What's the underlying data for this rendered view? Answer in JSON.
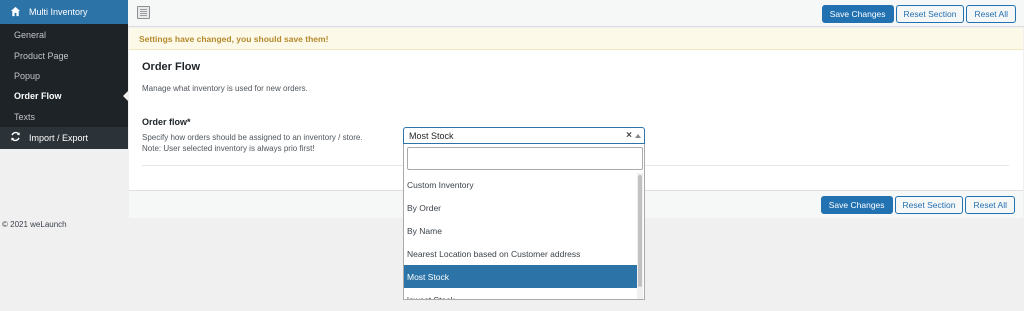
{
  "sidebar": {
    "title": "Multi Inventory",
    "items": [
      {
        "label": "General"
      },
      {
        "label": "Product Page"
      },
      {
        "label": "Popup"
      },
      {
        "label": "Order Flow"
      },
      {
        "label": "Texts"
      }
    ],
    "import_export": "Import / Export"
  },
  "toolbar": {
    "save_label": "Save Changes",
    "reset_section_label": "Reset Section",
    "reset_all_label": "Reset All"
  },
  "notice": "Settings have changed, you should save them!",
  "section": {
    "title": "Order Flow",
    "description": "Manage what inventory is used for new orders."
  },
  "field": {
    "label": "Order flow*",
    "desc_line1": "Specify how orders should be assigned to an inventory / store.",
    "desc_line2": "Note: User selected inventory is always prio first!",
    "selected": "Most Stock",
    "clear": "×",
    "options": [
      "Custom Inventory",
      "By Order",
      "By Name",
      "Nearest Location based on Customer address",
      "Most Stock",
      "lowest Stock"
    ],
    "selected_index": 4
  },
  "footer": "© 2021 weLaunch",
  "colors": {
    "accent": "#2271b1",
    "sidebar_bg": "#1d2327",
    "notice_text": "#b58a2e"
  }
}
